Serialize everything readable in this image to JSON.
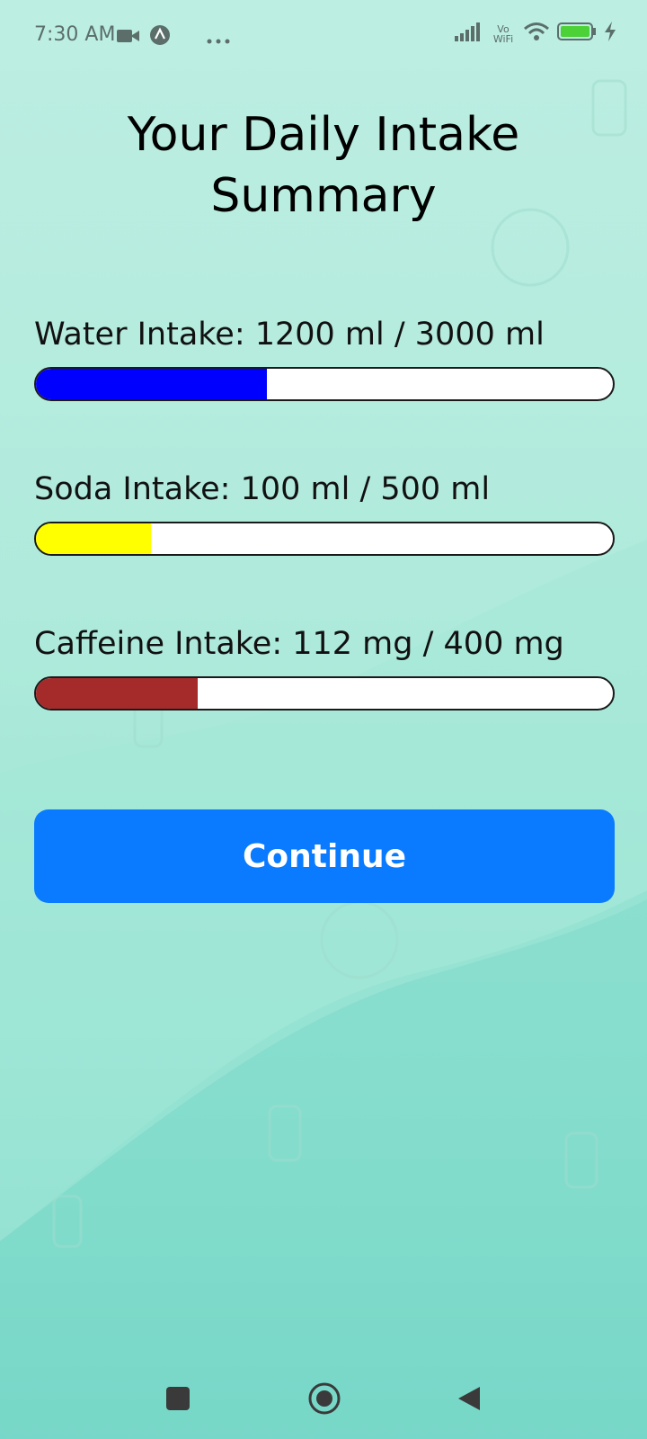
{
  "status_bar": {
    "time": "7:30 AM",
    "network_label": "Vo WiFi",
    "battery_level": 0.95,
    "icons": [
      "video-camera-icon",
      "app-notification-icon",
      "more-dots-icon",
      "signal-icon",
      "wifi-icon",
      "battery-icon",
      "charging-icon"
    ]
  },
  "title_line1": "Your Daily Intake",
  "title_line2": "Summary",
  "metrics": [
    {
      "label": "Water Intake: 1200 ml / 3000 ml",
      "current": 1200,
      "target": 3000,
      "unit": "ml",
      "color": "#0000ff"
    },
    {
      "label": "Soda Intake: 100 ml / 500 ml",
      "current": 100,
      "target": 500,
      "unit": "ml",
      "color": "#ffff00"
    },
    {
      "label": "Caffeine Intake: 112 mg / 400 mg",
      "current": 112,
      "target": 400,
      "unit": "mg",
      "color": "#a52a2a"
    }
  ],
  "continue_label": "Continue",
  "colors": {
    "accent": "#0a7bff",
    "background": "#b3ecdf"
  },
  "nav": {
    "icons": [
      "recents-square-icon",
      "home-circle-icon",
      "back-triangle-icon"
    ]
  }
}
